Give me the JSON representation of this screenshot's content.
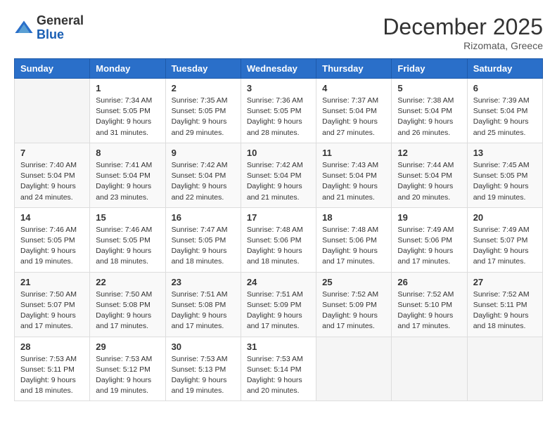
{
  "header": {
    "logo_general": "General",
    "logo_blue": "Blue",
    "month_title": "December 2025",
    "location": "Rizomata, Greece"
  },
  "weekdays": [
    "Sunday",
    "Monday",
    "Tuesday",
    "Wednesday",
    "Thursday",
    "Friday",
    "Saturday"
  ],
  "weeks": [
    [
      null,
      {
        "day": "1",
        "sunrise": "7:34 AM",
        "sunset": "5:05 PM",
        "daylight": "9 hours and 31 minutes."
      },
      {
        "day": "2",
        "sunrise": "7:35 AM",
        "sunset": "5:05 PM",
        "daylight": "9 hours and 29 minutes."
      },
      {
        "day": "3",
        "sunrise": "7:36 AM",
        "sunset": "5:05 PM",
        "daylight": "9 hours and 28 minutes."
      },
      {
        "day": "4",
        "sunrise": "7:37 AM",
        "sunset": "5:04 PM",
        "daylight": "9 hours and 27 minutes."
      },
      {
        "day": "5",
        "sunrise": "7:38 AM",
        "sunset": "5:04 PM",
        "daylight": "9 hours and 26 minutes."
      },
      {
        "day": "6",
        "sunrise": "7:39 AM",
        "sunset": "5:04 PM",
        "daylight": "9 hours and 25 minutes."
      }
    ],
    [
      {
        "day": "7",
        "sunrise": "7:40 AM",
        "sunset": "5:04 PM",
        "daylight": "9 hours and 24 minutes."
      },
      {
        "day": "8",
        "sunrise": "7:41 AM",
        "sunset": "5:04 PM",
        "daylight": "9 hours and 23 minutes."
      },
      {
        "day": "9",
        "sunrise": "7:42 AM",
        "sunset": "5:04 PM",
        "daylight": "9 hours and 22 minutes."
      },
      {
        "day": "10",
        "sunrise": "7:42 AM",
        "sunset": "5:04 PM",
        "daylight": "9 hours and 21 minutes."
      },
      {
        "day": "11",
        "sunrise": "7:43 AM",
        "sunset": "5:04 PM",
        "daylight": "9 hours and 21 minutes."
      },
      {
        "day": "12",
        "sunrise": "7:44 AM",
        "sunset": "5:04 PM",
        "daylight": "9 hours and 20 minutes."
      },
      {
        "day": "13",
        "sunrise": "7:45 AM",
        "sunset": "5:05 PM",
        "daylight": "9 hours and 19 minutes."
      }
    ],
    [
      {
        "day": "14",
        "sunrise": "7:46 AM",
        "sunset": "5:05 PM",
        "daylight": "9 hours and 19 minutes."
      },
      {
        "day": "15",
        "sunrise": "7:46 AM",
        "sunset": "5:05 PM",
        "daylight": "9 hours and 18 minutes."
      },
      {
        "day": "16",
        "sunrise": "7:47 AM",
        "sunset": "5:05 PM",
        "daylight": "9 hours and 18 minutes."
      },
      {
        "day": "17",
        "sunrise": "7:48 AM",
        "sunset": "5:06 PM",
        "daylight": "9 hours and 18 minutes."
      },
      {
        "day": "18",
        "sunrise": "7:48 AM",
        "sunset": "5:06 PM",
        "daylight": "9 hours and 17 minutes."
      },
      {
        "day": "19",
        "sunrise": "7:49 AM",
        "sunset": "5:06 PM",
        "daylight": "9 hours and 17 minutes."
      },
      {
        "day": "20",
        "sunrise": "7:49 AM",
        "sunset": "5:07 PM",
        "daylight": "9 hours and 17 minutes."
      }
    ],
    [
      {
        "day": "21",
        "sunrise": "7:50 AM",
        "sunset": "5:07 PM",
        "daylight": "9 hours and 17 minutes."
      },
      {
        "day": "22",
        "sunrise": "7:50 AM",
        "sunset": "5:08 PM",
        "daylight": "9 hours and 17 minutes."
      },
      {
        "day": "23",
        "sunrise": "7:51 AM",
        "sunset": "5:08 PM",
        "daylight": "9 hours and 17 minutes."
      },
      {
        "day": "24",
        "sunrise": "7:51 AM",
        "sunset": "5:09 PM",
        "daylight": "9 hours and 17 minutes."
      },
      {
        "day": "25",
        "sunrise": "7:52 AM",
        "sunset": "5:09 PM",
        "daylight": "9 hours and 17 minutes."
      },
      {
        "day": "26",
        "sunrise": "7:52 AM",
        "sunset": "5:10 PM",
        "daylight": "9 hours and 17 minutes."
      },
      {
        "day": "27",
        "sunrise": "7:52 AM",
        "sunset": "5:11 PM",
        "daylight": "9 hours and 18 minutes."
      }
    ],
    [
      {
        "day": "28",
        "sunrise": "7:53 AM",
        "sunset": "5:11 PM",
        "daylight": "9 hours and 18 minutes."
      },
      {
        "day": "29",
        "sunrise": "7:53 AM",
        "sunset": "5:12 PM",
        "daylight": "9 hours and 19 minutes."
      },
      {
        "day": "30",
        "sunrise": "7:53 AM",
        "sunset": "5:13 PM",
        "daylight": "9 hours and 19 minutes."
      },
      {
        "day": "31",
        "sunrise": "7:53 AM",
        "sunset": "5:14 PM",
        "daylight": "9 hours and 20 minutes."
      },
      null,
      null,
      null
    ]
  ]
}
